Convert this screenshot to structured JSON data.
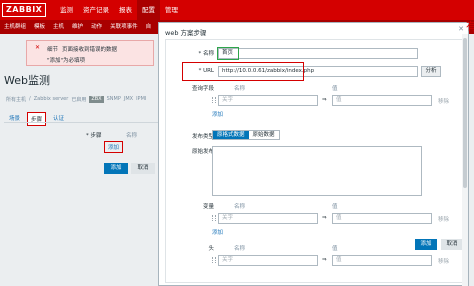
{
  "logo": "ZABBIX",
  "top_nav": [
    "监测",
    "资产记录",
    "报表",
    "配置",
    "管理"
  ],
  "top_nav_active": 3,
  "sub_nav": [
    "主机群组",
    "模板",
    "主机",
    "维护",
    "动作",
    "关联项事件",
    "自"
  ],
  "error_box": {
    "icon": "✕",
    "line1_prefix": "细节",
    "line1": "页面接收到错误的数据",
    "line2": "\"添加\"为必填项"
  },
  "page": {
    "title": "Web监测",
    "breadcrumbs": [
      "所有主机",
      "/",
      "Zabbix server",
      "已启用",
      "ZBX",
      "SNMP",
      "JMX",
      "IPMI"
    ],
    "tabs": [
      "场景",
      "步骤",
      "认证"
    ],
    "active_tab": 1,
    "steps_label": "* 步骤",
    "name_column": "名称",
    "add_link": "添加",
    "add_button": "添加",
    "cancel_button": "取消"
  },
  "modal": {
    "title": "web 方案步骤",
    "close": "✕",
    "name_label": "* 名称",
    "name_value": "首页",
    "url_label": "* URL",
    "url_value": "http://10.0.0.61/zabbix/index.php",
    "parse_button": "分析",
    "query_label": "查询字段",
    "name_col": "名称",
    "value_col": "值",
    "key_placeholder": "关字",
    "value_placeholder": "值",
    "remove": "移除",
    "add": "添加",
    "post_type_label": "发布类型",
    "post_types": [
      "原格式数据",
      "原始数据"
    ],
    "post_type_active": 0,
    "post_fields_label": "原始发布",
    "variables_label": "变量",
    "headers_label": "头",
    "footer_add": "添加",
    "footer_cancel": "取消"
  },
  "watermark": "有",
  "colors": {
    "brand_red": "#d40000",
    "primary_blue": "#0275b8",
    "link_blue": "#1a73b8",
    "highlight_red": "#d40000",
    "highlight_green": "#2ea54a"
  }
}
